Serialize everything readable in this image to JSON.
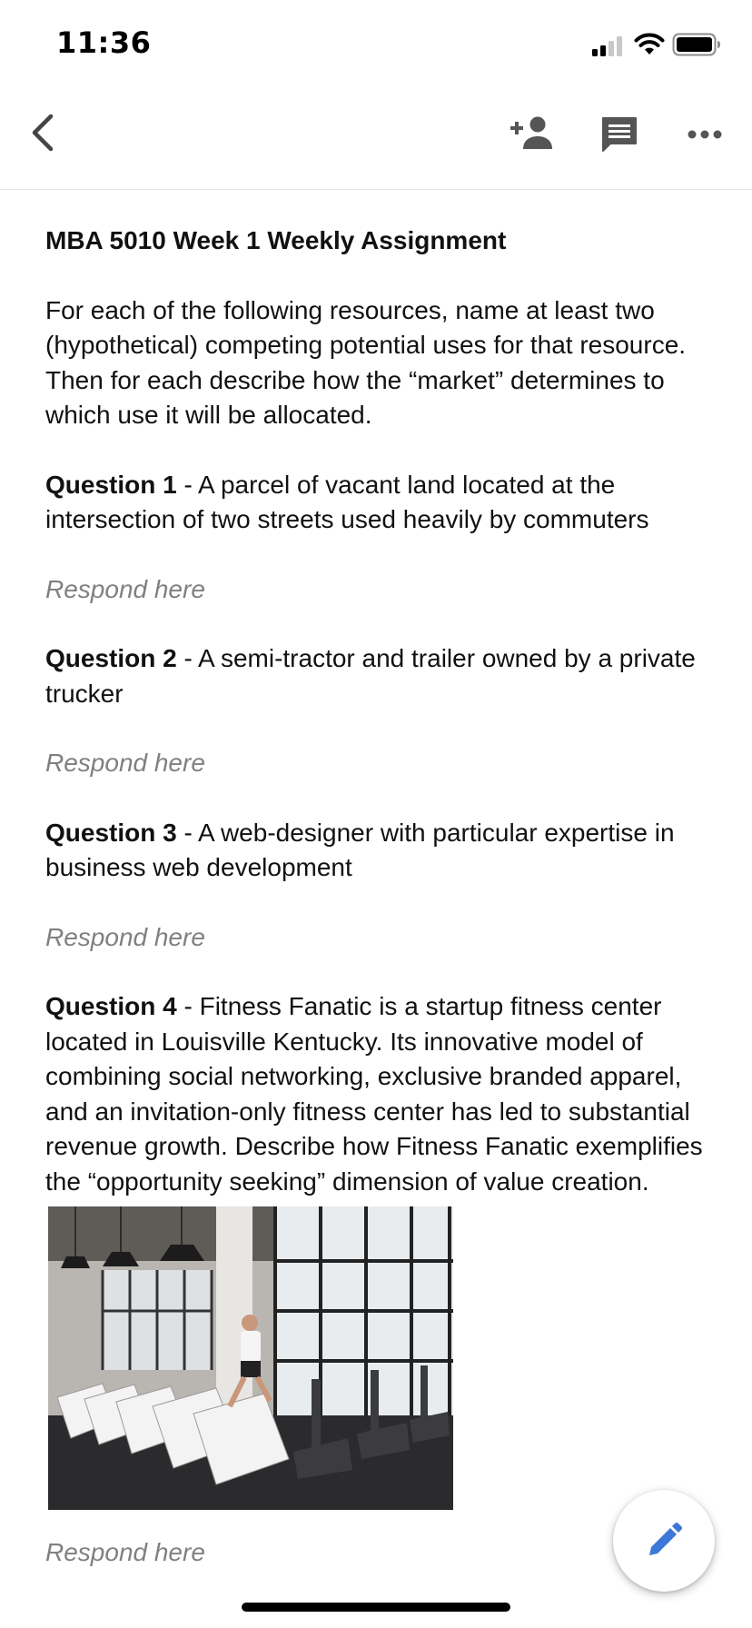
{
  "status_bar": {
    "time": "11:36"
  },
  "toolbar": {
    "icons": [
      "back-arrow-icon",
      "add-person-icon",
      "comment-icon",
      "more-horizontal-icon"
    ]
  },
  "document": {
    "title": "MBA 5010 Week 1 Weekly Assignment",
    "intro": "For each of the following resources, name at least two (hypothetical) competing potential uses for that resource.  Then for each describe how the “market” determines to which use it will be allocated.",
    "questions": [
      {
        "label": "Question 1",
        "text": " - A parcel of vacant land located at the intersection of two streets used heavily by commuters",
        "response": "Respond here"
      },
      {
        "label": "Question 2",
        "text": " - A semi-tractor and trailer owned by a private trucker",
        "response": "Respond here"
      },
      {
        "label": "Question 3",
        "text": " - A web-designer with particular expertise in business web development",
        "response": "Respond here"
      },
      {
        "label": "Question 4",
        "text": " - Fitness Fanatic is a startup fitness center located in Louisville Kentucky.  Its innovative model of combining social networking, exclusive branded apparel, and an invitation-only fitness center has led to substantial revenue growth.  Describe how Fitness Fanatic exemplifies the “opportunity seeking” dimension of value creation.",
        "response": "Respond here"
      }
    ]
  },
  "fab": {
    "icon": "edit-pencil-icon",
    "color": "#3c78d8"
  }
}
